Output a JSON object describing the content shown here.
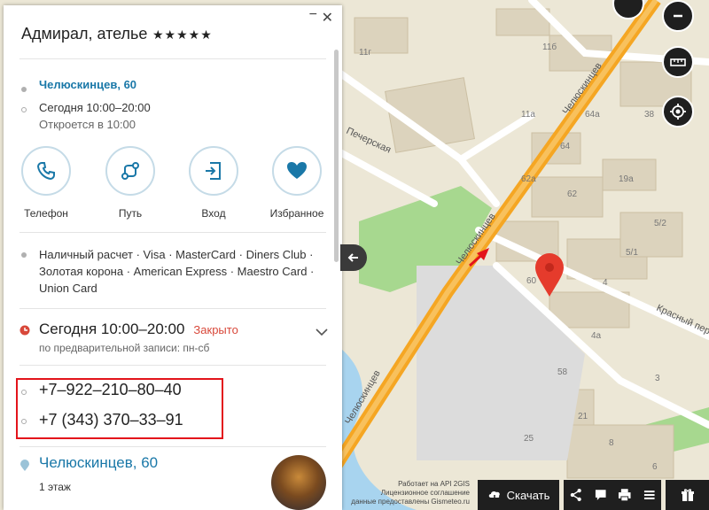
{
  "panel": {
    "title": "Адмирал, ателье",
    "stars": "★★★★★",
    "address_link": "Челюскинцев, 60",
    "hours_today": "Сегодня 10:00–20:00",
    "opens_note": "Откроется в 10:00",
    "actions": [
      {
        "label": "Телефон",
        "icon": "phone-icon"
      },
      {
        "label": "Путь",
        "icon": "route-icon"
      },
      {
        "label": "Вход",
        "icon": "entrance-icon"
      },
      {
        "label": "Избранное",
        "icon": "heart-icon"
      }
    ],
    "payment": "Наличный расчет · Visa · MasterCard · Diners Club · Золотая корона · American Express · Maestro Card · Union Card",
    "schedule_main": "Сегодня 10:00–20:00",
    "schedule_status": "Закрыто",
    "schedule_note": "по предварительной записи: пн-сб",
    "phones": [
      "+7–922–210–80–40",
      "+7 (343) 370–33–91"
    ],
    "address2": "Челюскинцев, 60",
    "floor": "1 этаж"
  },
  "map": {
    "street_labels": [
      "Челюскинцев",
      "Челюскинцев",
      "Челюскинцев",
      "Печерская",
      "Красный пер"
    ],
    "house_labels": [
      "11г",
      "11б",
      "11а",
      "64а",
      "38",
      "64",
      "19а",
      "62а",
      "62",
      "5/2",
      "5/1",
      "60",
      "4",
      "4а",
      "58",
      "3",
      "21",
      "25",
      "8",
      "6"
    ]
  },
  "controls": {
    "download": "Скачать"
  },
  "credits": [
    "Работает на API 2GIS",
    "Лицензионное соглашение",
    "данные предоставлены Gismeteo.ru"
  ],
  "colors": {
    "road_main": "#f5a623",
    "link": "#1a78a8",
    "closed": "#d8483a",
    "highlight": "#e3141b",
    "marker": "#e53b2c",
    "water": "#a8d4ef",
    "park": "#a7d88f"
  }
}
